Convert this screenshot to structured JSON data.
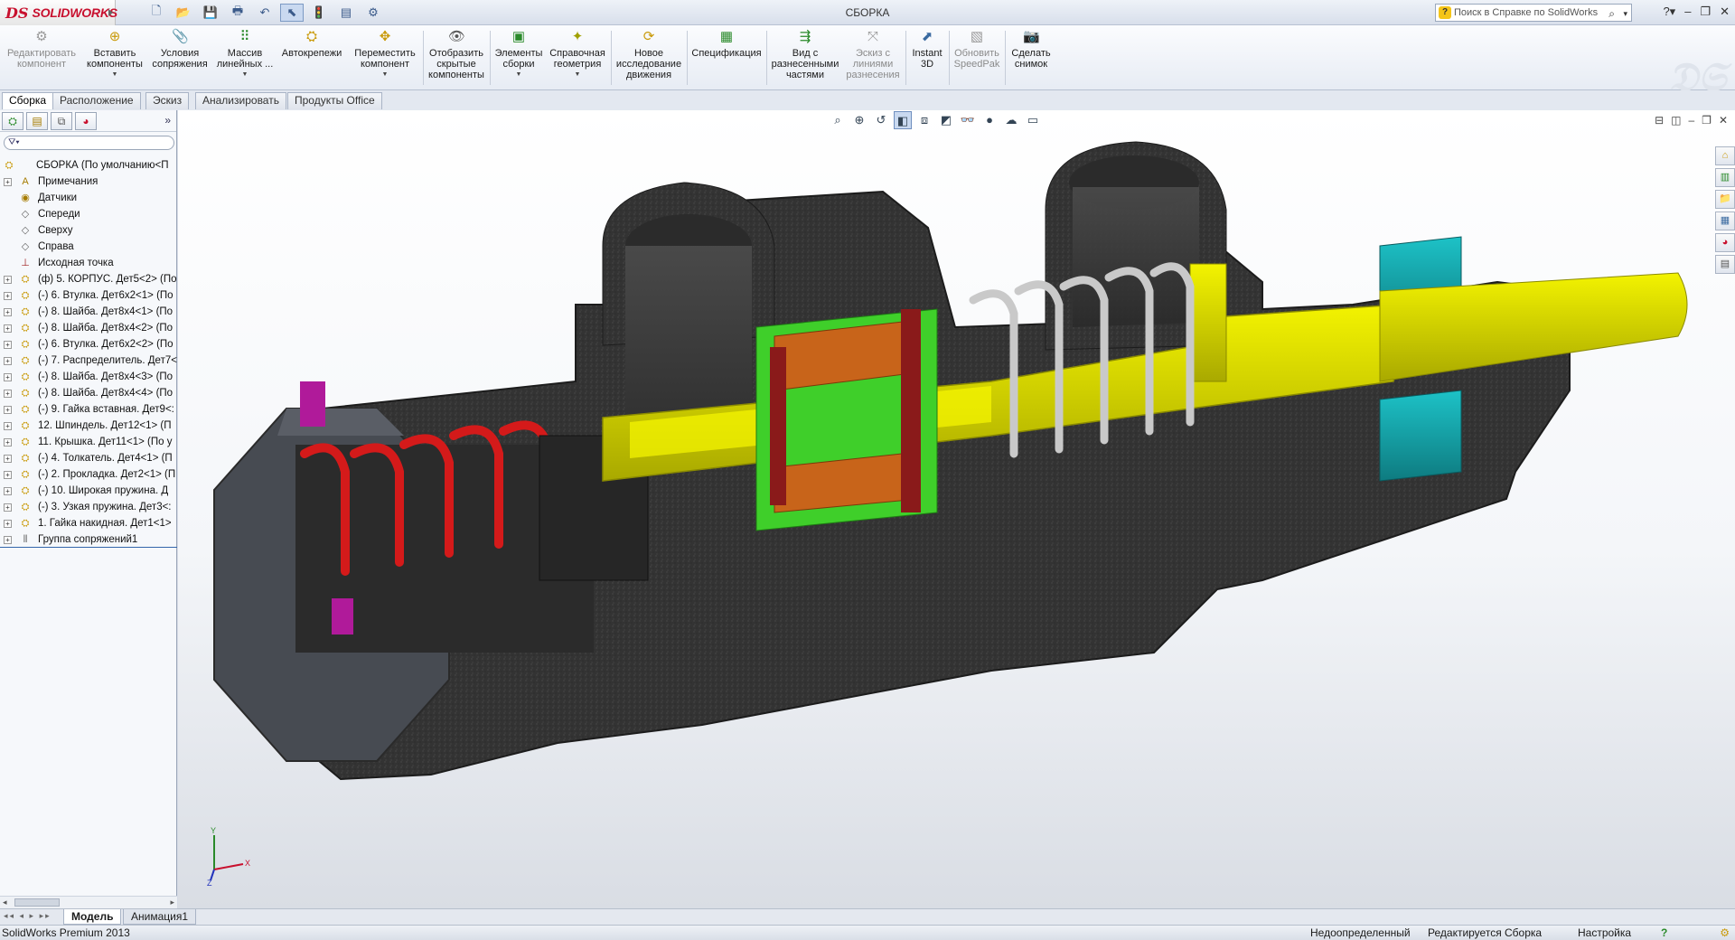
{
  "app": {
    "logo_ds": "DS",
    "logo_text": "SOLIDWORKS",
    "window_title": "СБОРКА",
    "help_search_placeholder": "Поиск в Справке по SolidWorks"
  },
  "quick_access": [
    "new",
    "open",
    "save",
    "print",
    "undo",
    "select",
    "rebuild",
    "file-properties",
    "options"
  ],
  "commands": [
    {
      "label": "Редактировать\nкомпонент",
      "icon": "edit-component-icon",
      "disabled": true
    },
    {
      "label": "Вставить\nкомпоненты",
      "icon": "insert-components-icon",
      "dropdown": true
    },
    {
      "label": "Условия\nсопряжения",
      "icon": "mate-icon"
    },
    {
      "label": "Массив\nлинейных ...",
      "icon": "linear-pattern-icon",
      "dropdown": true
    },
    {
      "label": "Автокрепежи",
      "icon": "smart-fasteners-icon"
    },
    {
      "label": "Переместить\nкомпонент",
      "icon": "move-component-icon",
      "dropdown": true
    },
    {
      "label": "Отобразить\nскрытые\nкомпоненты",
      "icon": "show-hidden-icon"
    },
    {
      "label": "Элементы\nсборки",
      "icon": "assembly-features-icon",
      "dropdown": true
    },
    {
      "label": "Справочная\nгеометрия",
      "icon": "reference-geometry-icon",
      "dropdown": true
    },
    {
      "label": "Новое\nисследование\nдвижения",
      "icon": "motion-study-icon"
    },
    {
      "label": "Спецификация",
      "icon": "bom-icon"
    },
    {
      "label": "Вид с\nразнесенными\nчастями",
      "icon": "exploded-view-icon"
    },
    {
      "label": "Эскиз с\nлиниями\nразнесения",
      "icon": "explode-line-sketch-icon",
      "disabled": true
    },
    {
      "label": "Instant\n3D",
      "icon": "instant3d-icon"
    },
    {
      "label": "Обновить\nSpeedPak",
      "icon": "speedpak-icon",
      "disabled": true
    },
    {
      "label": "Сделать\nснимок",
      "icon": "snapshot-icon"
    }
  ],
  "command_tabs": [
    {
      "label": "Сборка",
      "active": true
    },
    {
      "label": "Расположение"
    },
    {
      "label": "Эскиз"
    },
    {
      "label": "Анализировать"
    },
    {
      "label": "Продукты Office"
    }
  ],
  "feature_tree": {
    "root": "СБОРКА  (По умолчанию<П",
    "items": [
      {
        "label": "Примечания",
        "icon": "annotations-icon",
        "expandable": true
      },
      {
        "label": "Датчики",
        "icon": "sensors-icon"
      },
      {
        "label": "Спереди",
        "icon": "plane-icon"
      },
      {
        "label": "Сверху",
        "icon": "plane-icon"
      },
      {
        "label": "Справа",
        "icon": "plane-icon"
      },
      {
        "label": "Исходная точка",
        "icon": "origin-icon"
      },
      {
        "label": "(ф) 5. КОРПУС. Дет5<2>  (По",
        "icon": "part-icon",
        "expandable": true
      },
      {
        "label": "(-) 6. Втулка. Дет6х2<1>  (По",
        "icon": "part-icon",
        "expandable": true
      },
      {
        "label": "(-) 8. Шайба. Дет8х4<1>  (По",
        "icon": "part-icon",
        "expandable": true
      },
      {
        "label": "(-) 8. Шайба. Дет8х4<2>  (По",
        "icon": "part-icon",
        "expandable": true
      },
      {
        "label": "(-) 6. Втулка. Дет6х2<2>  (По",
        "icon": "part-icon",
        "expandable": true
      },
      {
        "label": "(-) 7. Распределитель. Дет7<",
        "icon": "part-icon",
        "expandable": true
      },
      {
        "label": "(-) 8. Шайба. Дет8х4<3>  (По",
        "icon": "part-icon",
        "expandable": true
      },
      {
        "label": "(-) 8. Шайба. Дет8х4<4>  (По",
        "icon": "part-icon",
        "expandable": true
      },
      {
        "label": "(-) 9. Гайка вставная. Дет9<:",
        "icon": "part-icon",
        "expandable": true
      },
      {
        "label": "12. Шпиндель. Дет12<1>  (П",
        "icon": "part-icon",
        "expandable": true
      },
      {
        "label": "11. Крышка. Дет11<1>  (По у",
        "icon": "part-icon",
        "expandable": true
      },
      {
        "label": "(-) 4. Толкатель. Дет4<1>  (П",
        "icon": "part-icon",
        "expandable": true
      },
      {
        "label": "(-) 2. Прокладка. Дет2<1>  (П",
        "icon": "part-icon",
        "expandable": true
      },
      {
        "label": "(-) 10. Широкая пружина. Д",
        "icon": "part-icon",
        "expandable": true
      },
      {
        "label": "(-) 3. Узкая пружина. Дет3<:",
        "icon": "part-icon",
        "expandable": true
      },
      {
        "label": "1. Гайка накидная. Дет1<1>",
        "icon": "part-icon",
        "expandable": true
      },
      {
        "label": "Группа сопряжений1",
        "icon": "mates-group-icon",
        "expandable": true
      }
    ]
  },
  "triad": {
    "x": "X",
    "y": "Y",
    "z": "Z"
  },
  "bottom_tabs": [
    {
      "label": "Модель",
      "active": true
    },
    {
      "label": "Анимация1"
    }
  ],
  "status": {
    "product": "SolidWorks Premium 2013",
    "definition": "Недоопределенный",
    "editing": "Редактируется Сборка",
    "customize": "Настройка",
    "help": "?"
  },
  "colors": {
    "accent": "#c8102e",
    "body": "#3a3a3a",
    "spool": "#d4d400",
    "cap": "#13a3a8",
    "spring_red": "#d41a1a",
    "washer_orange": "#c8641a",
    "bushing_green": "#3fcf2a",
    "gasket_magenta": "#b01a9a"
  }
}
